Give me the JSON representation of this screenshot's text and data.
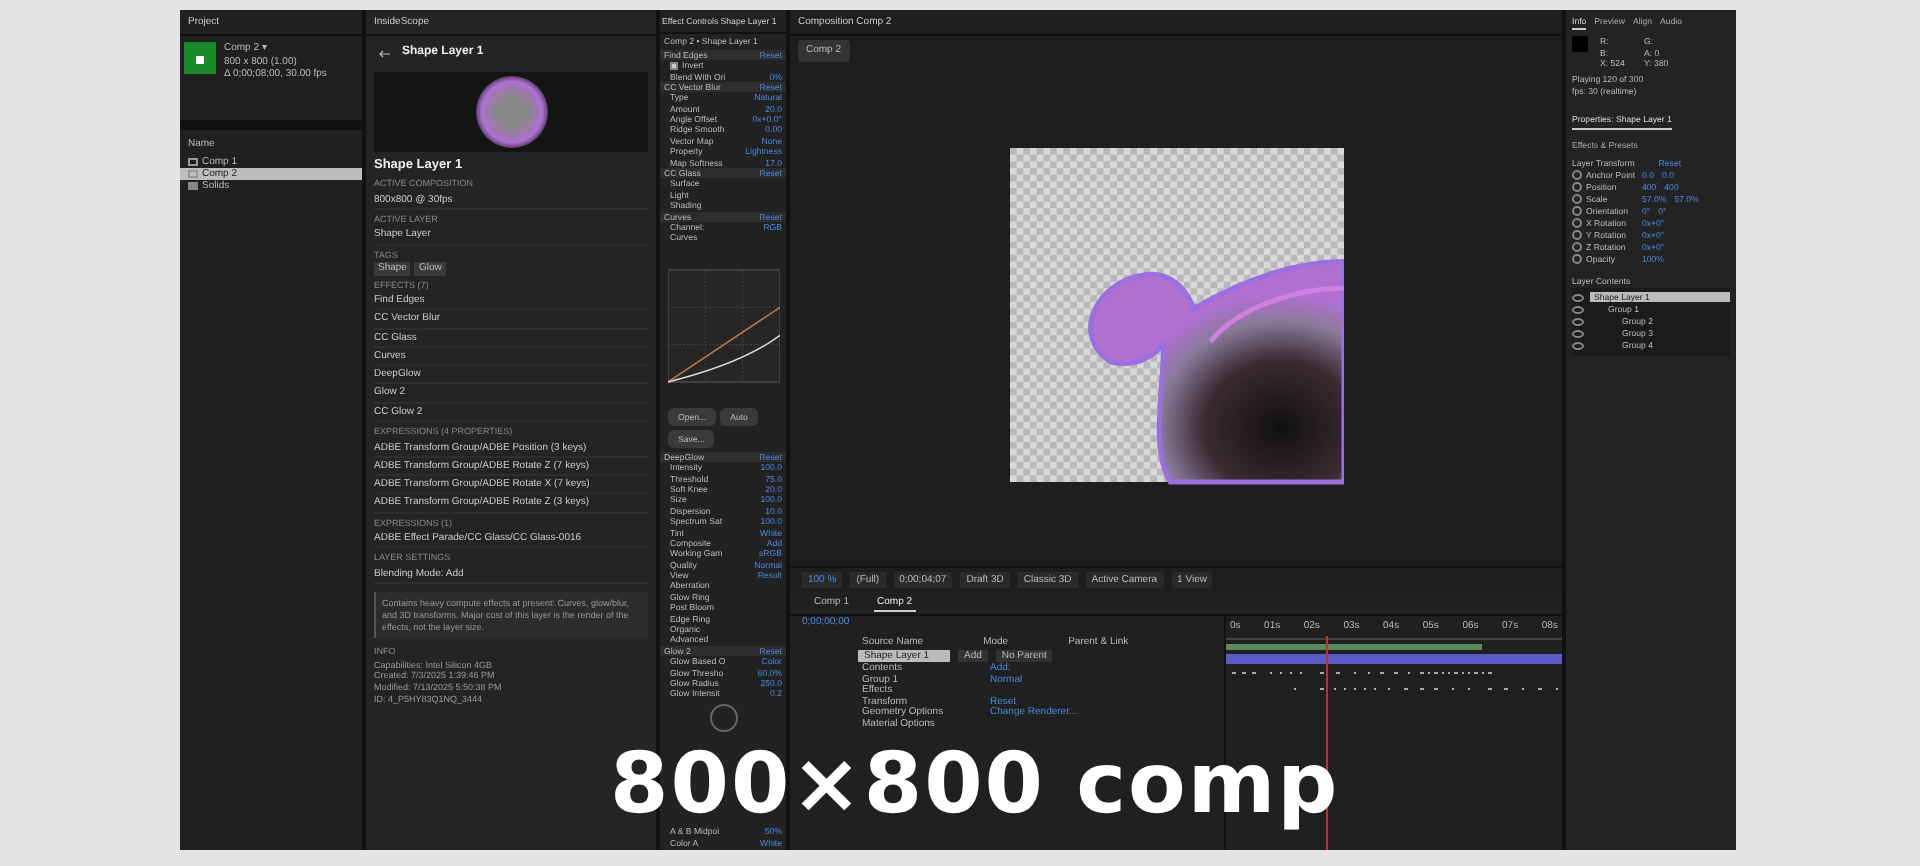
{
  "project": {
    "title": "Project",
    "comp_name": "Comp 2 ▾",
    "comp_size": "800 x 800 (1.00)",
    "comp_duration": "Δ 0;00;08;00, 30.00 fps",
    "column": "Name",
    "items": [
      {
        "kind": "comp",
        "label": "Comp 1",
        "selected": false
      },
      {
        "kind": "comp",
        "label": "Comp 2",
        "selected": true
      },
      {
        "kind": "folder",
        "label": "Solids",
        "selected": false
      }
    ]
  },
  "inspector": {
    "title": "InsideScope",
    "header": "Shape Layer 1",
    "layer_name": "Shape Layer 1",
    "sections": [
      {
        "heading": "ACTIVE COMPOSITION",
        "lines": [
          "800x800 @ 30fps"
        ]
      },
      {
        "heading": "ACTIVE LAYER",
        "lines": [
          "Shape Layer"
        ]
      },
      {
        "heading": "TAGS",
        "chips": [
          "Shape",
          "Glow"
        ]
      },
      {
        "heading": "EFFECTS (7)",
        "lines": [
          "Find Edges",
          "CC Vector Blur",
          "CC Glass",
          "Curves",
          "DeepGlow",
          "Glow 2",
          "CC Glow 2"
        ]
      },
      {
        "heading": "EXPRESSIONS (4 PROPERTIES)",
        "lines": [
          "ADBE Transform Group/ADBE Position (3 keys)",
          "ADBE Transform Group/ADBE Rotate Z (7 keys)",
          "ADBE Transform Group/ADBE Rotate X (7 keys)",
          "ADBE Transform Group/ADBE Rotate Z (3 keys)"
        ]
      },
      {
        "heading": "EXPRESSIONS (1)",
        "lines": [
          "ADBE Effect Parade/CC Glass/CC Glass-0016"
        ]
      },
      {
        "heading": "LAYER SETTINGS",
        "lines": [
          "Blending Mode: Add"
        ]
      }
    ],
    "note": "Contains heavy compute effects at present: Curves, glow/blur, and 3D transforms. Major cost of this layer is the render of the effects, not the layer size.",
    "info_heading": "INFO",
    "info_lines": [
      "Capabilities: Intel Silicon 4GB",
      "Created: 7/3/2025 1:39:46 PM",
      "Modified: 7/13/2025 5:50:38 PM",
      "ID: 4_P5HY83Q1NQ_3444"
    ]
  },
  "effect_controls": {
    "title": "Effect Controls Shape Layer 1",
    "subtitle": "Comp 2 • Shape Layer 1",
    "rows_top": [
      {
        "kind": "effect",
        "label": "Find Edges",
        "value": "Reset"
      },
      {
        "kind": "checkbox",
        "label": "Invert",
        "checked": true
      },
      {
        "kind": "param",
        "label": "Blend With Ori",
        "value": "0%"
      },
      {
        "kind": "effect",
        "label": "CC Vector Blur",
        "value": "Reset"
      },
      {
        "kind": "param",
        "label": "Type",
        "value": "Natural"
      },
      {
        "kind": "param",
        "label": "Amount",
        "value": "20.0"
      },
      {
        "kind": "param",
        "label": "Angle Offset",
        "value": "0x+0.0°"
      },
      {
        "kind": "param",
        "label": "Ridge Smooth",
        "value": "0.00"
      },
      {
        "kind": "param",
        "label": "Vector Map",
        "value": "None"
      },
      {
        "kind": "param",
        "label": "Property",
        "value": "Lightness"
      },
      {
        "kind": "param",
        "label": "Map Softness",
        "value": "17.0"
      },
      {
        "kind": "effect",
        "label": "CC Glass",
        "value": "Reset"
      },
      {
        "kind": "param",
        "label": "Surface"
      },
      {
        "kind": "param",
        "label": "Light"
      },
      {
        "kind": "param",
        "label": "Shading"
      },
      {
        "kind": "effect",
        "label": "Curves",
        "value": "Reset"
      },
      {
        "kind": "param",
        "label": "Channel:",
        "value": "RGB"
      },
      {
        "kind": "param",
        "label": "Curves"
      }
    ],
    "curve_buttons": [
      "Open...",
      "Auto",
      "Save..."
    ],
    "rows_bottom": [
      {
        "kind": "effect",
        "label": "DeepGlow",
        "value": "Reset"
      },
      {
        "kind": "param",
        "label": "Intensity",
        "value": "100.0"
      },
      {
        "kind": "param",
        "label": "Threshold",
        "value": "75.0"
      },
      {
        "kind": "param",
        "label": "Soft Knee",
        "value": "20.0"
      },
      {
        "kind": "param",
        "label": "Size",
        "value": "100.0"
      },
      {
        "kind": "param",
        "label": "Dispersion",
        "value": "10.0"
      },
      {
        "kind": "param",
        "label": "Spectrum Sat",
        "value": "100.0"
      },
      {
        "kind": "param",
        "label": "Tint",
        "value": "White"
      },
      {
        "kind": "param",
        "label": "Composite",
        "value": "Add"
      },
      {
        "kind": "param",
        "label": "Working Gam",
        "value": "sRGB"
      },
      {
        "kind": "param",
        "label": "Quality",
        "value": "Normal"
      },
      {
        "kind": "param",
        "label": "View",
        "value": "Result"
      },
      {
        "kind": "param",
        "label": "Aberration"
      },
      {
        "kind": "param",
        "label": "Glow Ring"
      },
      {
        "kind": "param",
        "label": "Post Bloom"
      },
      {
        "kind": "param",
        "label": "Edge Ring"
      },
      {
        "kind": "param",
        "label": "Organic"
      },
      {
        "kind": "param",
        "label": "Advanced"
      },
      {
        "kind": "effect",
        "label": "Glow 2",
        "value": "Reset"
      },
      {
        "kind": "param",
        "label": "Glow Based O",
        "value": "Color"
      },
      {
        "kind": "param",
        "label": "Glow Thresho",
        "value": "60.0%"
      },
      {
        "kind": "param",
        "label": "Glow Radius",
        "value": "250.0"
      },
      {
        "kind": "param",
        "label": "Glow Intensit",
        "value": "0.2"
      }
    ],
    "rows_end": [
      {
        "kind": "param",
        "label": "A & B Midpoi",
        "value": "50%"
      },
      {
        "kind": "param",
        "label": "Color A",
        "value": "White"
      }
    ]
  },
  "composition": {
    "tab": "Composition Comp 2",
    "breadcrumb": "Comp 2",
    "toolbar": [
      "100 %",
      "(Full)",
      "0;00;04;07",
      "Draft 3D",
      "Classic 3D",
      "Active Camera",
      "1 View"
    ]
  },
  "timeline": {
    "tabs": [
      {
        "label": "Comp 1",
        "selected": false
      },
      {
        "label": "Comp 2",
        "selected": true
      }
    ],
    "time": "0;00;00;00",
    "headers": [
      "Source Name",
      "Mode",
      "Parent & Link"
    ],
    "layer": {
      "name": "Shape Layer 1",
      "mode": "Add",
      "parent": "No Parent"
    },
    "sub_rows": [
      {
        "label": "Contents",
        "value": "Add:"
      },
      {
        "label": "Group 1",
        "value": "Normal"
      },
      {
        "label": "Effects"
      },
      {
        "label": "Transform",
        "value": "Reset"
      },
      {
        "label": "Geometry Options",
        "value": "Change Renderer..."
      },
      {
        "label": "Material Options"
      }
    ],
    "ruler": [
      "0s",
      "01s",
      "02s",
      "03s",
      "04s",
      "05s",
      "06s",
      "07s",
      "08s"
    ]
  },
  "right": {
    "tabs": [
      {
        "label": "Info",
        "selected": true
      },
      {
        "label": "Preview",
        "selected": false
      },
      {
        "label": "Align",
        "selected": false
      },
      {
        "label": "Audio",
        "selected": false
      }
    ],
    "readouts": [
      "R:",
      "G:",
      "B:",
      "A: 0",
      "X: 524",
      "Y: 380"
    ],
    "status": [
      "Playing 120 of 300",
      "fps: 30 (realtime)"
    ],
    "prop_tabs": [
      {
        "label": "Properties: Shape Layer 1",
        "selected": true
      },
      {
        "label": "Effects & Presets",
        "selected": false
      }
    ],
    "transform_heading": "Layer Transform",
    "transform_reset": "Reset",
    "props": [
      {
        "label": "Anchor Point",
        "values": [
          "0.0",
          "0.0"
        ]
      },
      {
        "label": "Position",
        "values": [
          "400",
          "400"
        ]
      },
      {
        "label": "Scale",
        "values": [
          "57.0%",
          "57.0%"
        ]
      },
      {
        "label": "Orientation",
        "values": [
          "0°",
          "0°"
        ]
      },
      {
        "label": "X Rotation",
        "values": [
          "0x+0°"
        ]
      },
      {
        "label": "Y Rotation",
        "values": [
          "0x+0°"
        ]
      },
      {
        "label": "Z Rotation",
        "values": [
          "0x+0°"
        ]
      },
      {
        "label": "Opacity",
        "values": [
          "100%"
        ]
      }
    ],
    "contents_heading": "Layer Contents",
    "contents": [
      {
        "label": "Shape Layer 1",
        "selected": true,
        "children": [
          {
            "label": "Group 1",
            "selected": false,
            "children": [
              {
                "label": "Group 2",
                "selected": false
              },
              {
                "label": "Group 3",
                "selected": false
              },
              {
                "label": "Group 4",
                "selected": false
              }
            ]
          }
        ]
      }
    ]
  },
  "caption": "800×800 comp"
}
